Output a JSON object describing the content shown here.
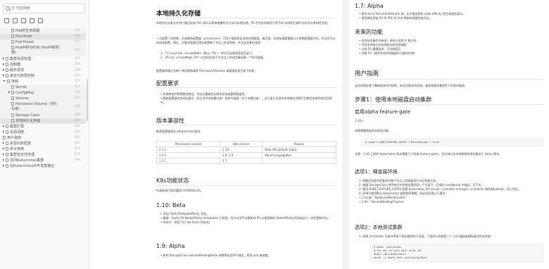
{
  "sidebar": {
    "search_placeholder": "Q 节选搜索",
    "tools": [
      "list-icon",
      "tree-icon",
      "expand-icon",
      "collapse-icon",
      "filter-icon"
    ],
    "items": [
      {
        "label": "Pod的生命周期",
        "num": "191",
        "child": true,
        "active": false
      },
      {
        "label": "Pod Hook",
        "num": "196",
        "child": true,
        "active": true
      },
      {
        "label": "Pod Preset",
        "num": "197",
        "child": true,
        "active": false
      },
      {
        "label": "Pod中断与PDB (Pod中断预算)",
        "num": "199",
        "child": true,
        "active": false,
        "two": true
      },
      {
        "label": "集群资源管理",
        "num": "203",
        "child": false
      },
      {
        "label": "控制器",
        "num": "209",
        "child": false
      },
      {
        "label": "服务发现",
        "num": "269",
        "child": false
      },
      {
        "label": "身份与权限控制",
        "num": "283",
        "child": false
      },
      {
        "label": "存储",
        "num": "311",
        "child": false,
        "open": true
      },
      {
        "label": "Secret",
        "num": "311",
        "child": true
      },
      {
        "label": "ConfigMap",
        "num": "316",
        "child": true,
        "caret": true
      },
      {
        "label": "Volume",
        "num": "332",
        "child": true
      },
      {
        "label": "Persistent Volume（持久化卷）",
        "num": "348",
        "child": true,
        "two": true
      },
      {
        "label": "Storage Class",
        "num": "360",
        "child": true
      },
      {
        "label": "本地持久化存储",
        "num": "365",
        "child": true,
        "active": true
      },
      {
        "label": "集群扩展",
        "num": "368",
        "child": false
      },
      {
        "label": "资源调度",
        "num": "391",
        "child": false
      },
      {
        "label": "用户指南",
        "num": "401",
        "child": false,
        "nocaret": true
      },
      {
        "label": "资源对象配置",
        "num": "404",
        "child": false
      },
      {
        "label": "命令使用",
        "num": "434",
        "child": false
      },
      {
        "label": "集群安全性管理",
        "num": "457",
        "child": false
      },
      {
        "label": "访问Kubernetes集群",
        "num": "496",
        "child": false
      },
      {
        "label": "在Kubernetes中开发部署应",
        "num": "",
        "child": false,
        "two": false
      }
    ]
  },
  "page1": {
    "title": "本地持久化存储",
    "intro": "本地持久化卷允许用户通过标准 PVC 接口以简单便携的方式访问本地存储。PV 中包含系统用于将 Pod 安排到正确节点的节点亲和性信息。",
    "intro2": "一旦配置了本地卷，外部静态配置器（provisioner）可用于帮助简化本地存储管理。请注意，本地存储配置器与大多数配置器不同，并且尚不支持动态配置。相反，它要求管理员预先配置每个节点上的本地卷，并且这些卷应该是：",
    "list1": [
      "1.  Filesystem volumeMode（默认）PV—— 将它们挂载到发现目录下。",
      "2.  Block volumeMode PV——在发现目录下为节点上的块设备创建一个符号链接。"
    ],
    "note": "配置器将通过为每个卷创建和清除 PersistentVolumes 来管理发现目录下的卷。",
    "h_req": "配置要求",
    "req": [
      "• 本地卷插件希望路径稳定，包括在重新启动时和添加或删除磁盘时。",
      "• 静态配置器仅发现挂载点（对于文件系统模式卷）或符号链接（对于块模式卷）。对于基于目录的本地卷必须将它们绑定安装到发现目录中。"
    ],
    "h_ver": "版本兼容性",
    "ver_note": "推荐配置器版本与Kubernetes版本",
    "table_head": [
      "Provisioner version",
      "K8s version",
      "Reason"
    ],
    "table_rows": [
      [
        "2.1.0",
        "1.10",
        "Beta API default, block"
      ],
      [
        "2.0.0",
        "1.8, 1.9",
        "Mount propagation"
      ],
      [
        "1.0.1",
        "1.7",
        ""
      ]
    ],
    "h_state": "K8s功能状态",
    "state_note": "另请参阅已知问题和 CHANGELOG。",
    "h_110": "1.10: Beta",
    "b110": [
      "• 添加了新的 PV.NodeAffinity 字段。",
      "• 重要：Alpha PV NodeAffinity annotation 已弃用。用户必须手动更新其 PV 以使用新的 NodeAffinity字段或运行一次性更新作业。",
      "• Alpha：添加了对 raw block 的支持。"
    ],
    "h_19": "1.9: Alpha",
    "b19": [
      "• 新的 StorageClass volumeBindingMode 参数将延迟PVC绑定，直到 pod 被调度。"
    ]
  },
  "page2": {
    "h_17": "1.7: Alpha",
    "b17": [
      "• 新的 local PersistentVolume 源，允许指定具有 node affinity 的目录或挂载点。",
      "• 使用绑定到该 PV 的 PVC 的 Pod 将始终调度到该节点。"
    ],
    "h_future": "未来的功能",
    "future": [
      "• 本地块设备作为卷源，具有分区和 fs 格式化",
      "• 共享本地持久化存储的动态资源调配",
      "• 当地 PV 健康监测、污点和容忍",
      "• 内联 PV（使用专用本地磁盘作为临时存储）"
    ],
    "h_guide": "用户指南",
    "guide_note": "这些说明反映了最新版本的代码库。有关旧版本的说明，请参阅版本兼容性下的版本链接。",
    "h_step1": "步骤1：使用本地磁盘启动集群",
    "h_enable": "启用alpha feature gate",
    "v110": "1.10+",
    "v110_note": "如果需要原始的本地块功能，",
    "code1": "$ export KUBE_FEATURE_GATES =\"BlockVolume = true\"",
    "note_19": "注意：1.10 之前的 Kubernetes 版本需要几个附加 feature gates，因为持久化本地卷和其他功能处于 alpha 版本。",
    "h_opt1": "选项1：裸金属环境",
    "opt1": [
      "1.  根据应用程序的要求对每个节点上的磁盘进行分区和格式化。",
      "2.  根据 StorageClass 将所有文件系统挂载到同一个目录下。目录在 configmap 中指定，见下文。",
      "3.  使用 KUBE_FEATURE_GATES 配置 Kubernetes API server, controller manager, scheduler 和所有kubelet，如上所述。",
      "4.  如果不使用默认 Kubernetes 调度程序策略，则必须启用以下谓词：",
      "    • 1.9之前：NoVolumeBindConflict",
      "    • 1.9+：VolumeBindingChecker"
    ],
    "h_opt2": "选项2：本地测试集群",
    "opt2": "1.  创建 /mnt/disks 目录并将多个卷挂载到其子目录。下面的示例使用三个 ram 磁盘来模拟真实的本地卷：",
    "code2": [
      "$ mkdir /mnt/disks",
      "$ for vol in vol1 vol2 vol3; do",
      "    mkdir /mnt/disks/$vol",
      "    mount -t tmpfs $vol /mnt/disks/$vol"
    ]
  }
}
